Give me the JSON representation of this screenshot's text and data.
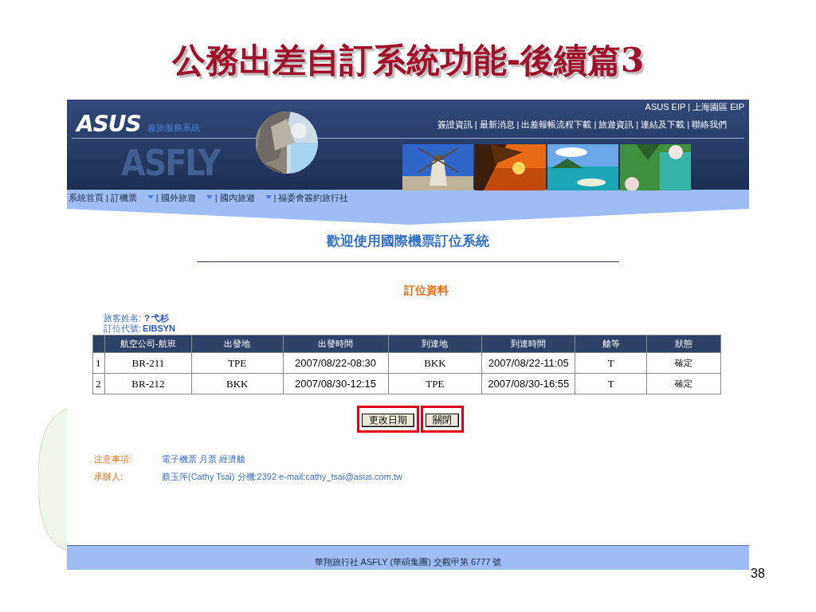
{
  "slide_title": "公務出差自訂系統功能-後續篇3",
  "header": {
    "top_links": [
      "ASUS EIP",
      "上海園區 EIP"
    ],
    "logo": "ASUS",
    "subtitle": "差旅服務系統",
    "brand": "ASFLY",
    "separator": "|",
    "links": [
      "簽證資訊",
      "最新消息",
      "出差報帳流程下載",
      "旅遊資訊",
      "連結及下載",
      "聯絡我們"
    ]
  },
  "nav": {
    "separator": "|",
    "items": [
      {
        "label": "系統首頁",
        "dropdown": false
      },
      {
        "label": "訂機票",
        "dropdown": true
      },
      {
        "label": "國外旅遊",
        "dropdown": true
      },
      {
        "label": "國內旅遊",
        "dropdown": true
      },
      {
        "label": "福委會簽約旅行社",
        "dropdown": false
      }
    ]
  },
  "page_heading": "歡迎使用國際機票訂位系統",
  "section_heading": "訂位資料",
  "info": [
    {
      "label": "旅客姓名:",
      "value": "？弋杉"
    },
    {
      "label": "訂位代號:",
      "value": "EIBSYN"
    }
  ],
  "table": {
    "columns": [
      "",
      "航空公司-航班",
      "出發地",
      "出發時間",
      "到達地",
      "到達時間",
      "艙等",
      "狀態"
    ],
    "rows": [
      [
        "1",
        "BR-211",
        "TPE",
        "2007/08/22-08:30",
        "BKK",
        "2007/08/22-11:05",
        "T",
        "確定"
      ],
      [
        "2",
        "BR-212",
        "BKK",
        "2007/08/30-12:15",
        "TPE",
        "2007/08/30-16:55",
        "T",
        "確定"
      ]
    ]
  },
  "buttons": [
    {
      "label": "更改日期",
      "highlighted": true
    },
    {
      "label": "關閉",
      "highlighted": true
    }
  ],
  "notes": [
    {
      "label": "注意事項:",
      "value": "電子機票 月票 經濟艙"
    },
    {
      "label": "承辦人:",
      "value": "蔡玉萍(Cathy Tsai) 分機:2392 e-mail:cathy_tsai@asus.com.tw"
    }
  ],
  "footer": "華翔旅行社 ASFLY (華碩集團) 交觀甲第 6777 號",
  "page_number": "38"
}
